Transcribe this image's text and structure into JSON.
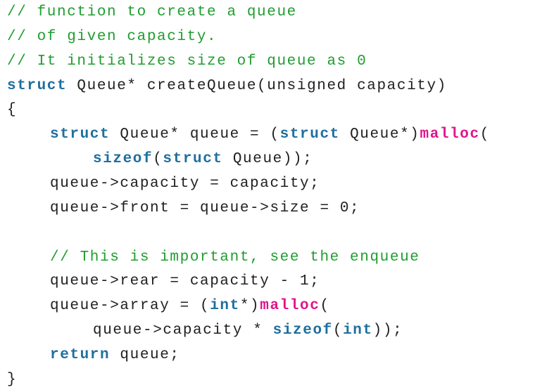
{
  "colors": {
    "comment": "#1f9d2f",
    "keyword": "#1f6f9e",
    "function": "#e0148c",
    "text": "#202020",
    "background": "#ffffff"
  },
  "code": {
    "lines": [
      {
        "indent": 0,
        "tokens": [
          {
            "type": "comment",
            "text": "// function to create a queue"
          }
        ]
      },
      {
        "indent": 0,
        "tokens": [
          {
            "type": "comment",
            "text": "// of given capacity."
          }
        ]
      },
      {
        "indent": 0,
        "tokens": [
          {
            "type": "comment",
            "text": "// It initializes size of queue as 0"
          }
        ]
      },
      {
        "indent": 0,
        "tokens": [
          {
            "type": "keyword",
            "text": "struct"
          },
          {
            "type": "plain",
            "text": " Queue* createQueue(unsigned capacity)"
          }
        ]
      },
      {
        "indent": 0,
        "tokens": [
          {
            "type": "plain",
            "text": "{"
          }
        ]
      },
      {
        "indent": 1,
        "tokens": [
          {
            "type": "keyword",
            "text": "struct"
          },
          {
            "type": "plain",
            "text": " Queue* queue = ("
          },
          {
            "type": "keyword",
            "text": "struct"
          },
          {
            "type": "plain",
            "text": " Queue*)"
          },
          {
            "type": "function",
            "text": "malloc"
          },
          {
            "type": "plain",
            "text": "("
          }
        ]
      },
      {
        "indent": 2,
        "tokens": [
          {
            "type": "keyword",
            "text": "sizeof"
          },
          {
            "type": "plain",
            "text": "("
          },
          {
            "type": "keyword",
            "text": "struct"
          },
          {
            "type": "plain",
            "text": " Queue));"
          }
        ]
      },
      {
        "indent": 1,
        "tokens": [
          {
            "type": "plain",
            "text": "queue->capacity = capacity;"
          }
        ]
      },
      {
        "indent": 1,
        "tokens": [
          {
            "type": "plain",
            "text": "queue->front = queue->size = 0;"
          }
        ]
      },
      {
        "indent": 0,
        "tokens": []
      },
      {
        "indent": 1,
        "tokens": [
          {
            "type": "comment",
            "text": "// This is important, see the enqueue"
          }
        ]
      },
      {
        "indent": 1,
        "tokens": [
          {
            "type": "plain",
            "text": "queue->rear = capacity - 1;"
          }
        ]
      },
      {
        "indent": 1,
        "tokens": [
          {
            "type": "plain",
            "text": "queue->array = ("
          },
          {
            "type": "keyword",
            "text": "int"
          },
          {
            "type": "plain",
            "text": "*)"
          },
          {
            "type": "function",
            "text": "malloc"
          },
          {
            "type": "plain",
            "text": "("
          }
        ]
      },
      {
        "indent": 2,
        "tokens": [
          {
            "type": "plain",
            "text": "queue->capacity * "
          },
          {
            "type": "keyword",
            "text": "sizeof"
          },
          {
            "type": "plain",
            "text": "("
          },
          {
            "type": "keyword",
            "text": "int"
          },
          {
            "type": "plain",
            "text": "));"
          }
        ]
      },
      {
        "indent": 1,
        "tokens": [
          {
            "type": "keyword",
            "text": "return"
          },
          {
            "type": "plain",
            "text": " queue;"
          }
        ]
      },
      {
        "indent": 0,
        "tokens": [
          {
            "type": "plain",
            "text": "}"
          }
        ]
      }
    ]
  }
}
